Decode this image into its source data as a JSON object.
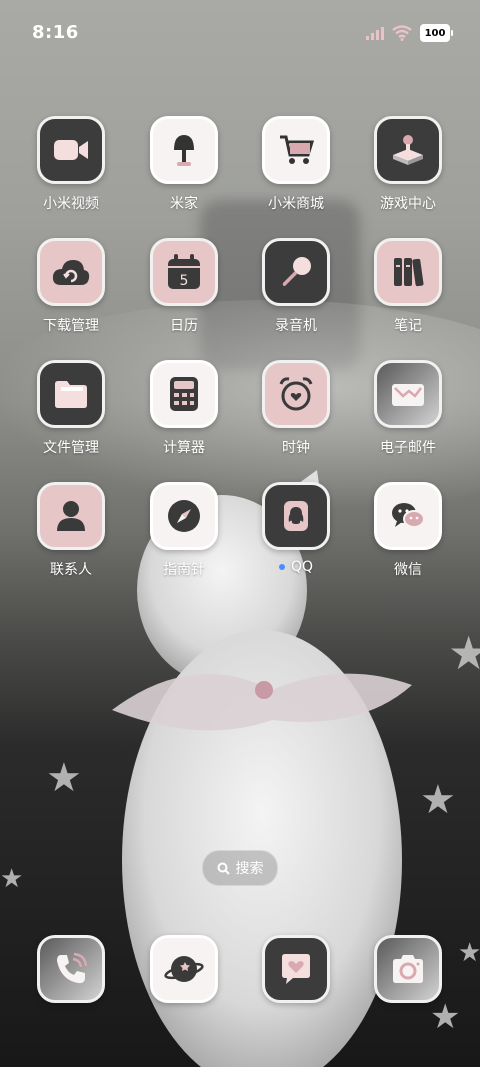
{
  "status_bar": {
    "time": "8:16",
    "battery": "100"
  },
  "apps": [
    {
      "label": "小米视频",
      "icon": "video-camera-icon"
    },
    {
      "label": "米家",
      "icon": "lamp-icon"
    },
    {
      "label": "小米商城",
      "icon": "shopping-cart-icon"
    },
    {
      "label": "游戏中心",
      "icon": "joystick-icon"
    },
    {
      "label": "下载管理",
      "icon": "cloud-refresh-icon"
    },
    {
      "label": "日历",
      "icon": "calendar-icon",
      "day": "5"
    },
    {
      "label": "录音机",
      "icon": "microphone-icon"
    },
    {
      "label": "笔记",
      "icon": "notes-icon"
    },
    {
      "label": "文件管理",
      "icon": "folder-icon"
    },
    {
      "label": "计算器",
      "icon": "calculator-icon"
    },
    {
      "label": "时钟",
      "icon": "alarm-clock-icon"
    },
    {
      "label": "电子邮件",
      "icon": "mail-icon"
    },
    {
      "label": "联系人",
      "icon": "contact-icon"
    },
    {
      "label": "指南针",
      "icon": "compass-icon"
    },
    {
      "label": "QQ",
      "icon": "qq-icon"
    },
    {
      "label": "微信",
      "icon": "wechat-icon"
    }
  ],
  "search": {
    "label": "搜索"
  },
  "dock": [
    {
      "icon": "phone-icon"
    },
    {
      "icon": "browser-planet-icon"
    },
    {
      "icon": "message-heart-icon"
    },
    {
      "icon": "camera-icon"
    }
  ]
}
